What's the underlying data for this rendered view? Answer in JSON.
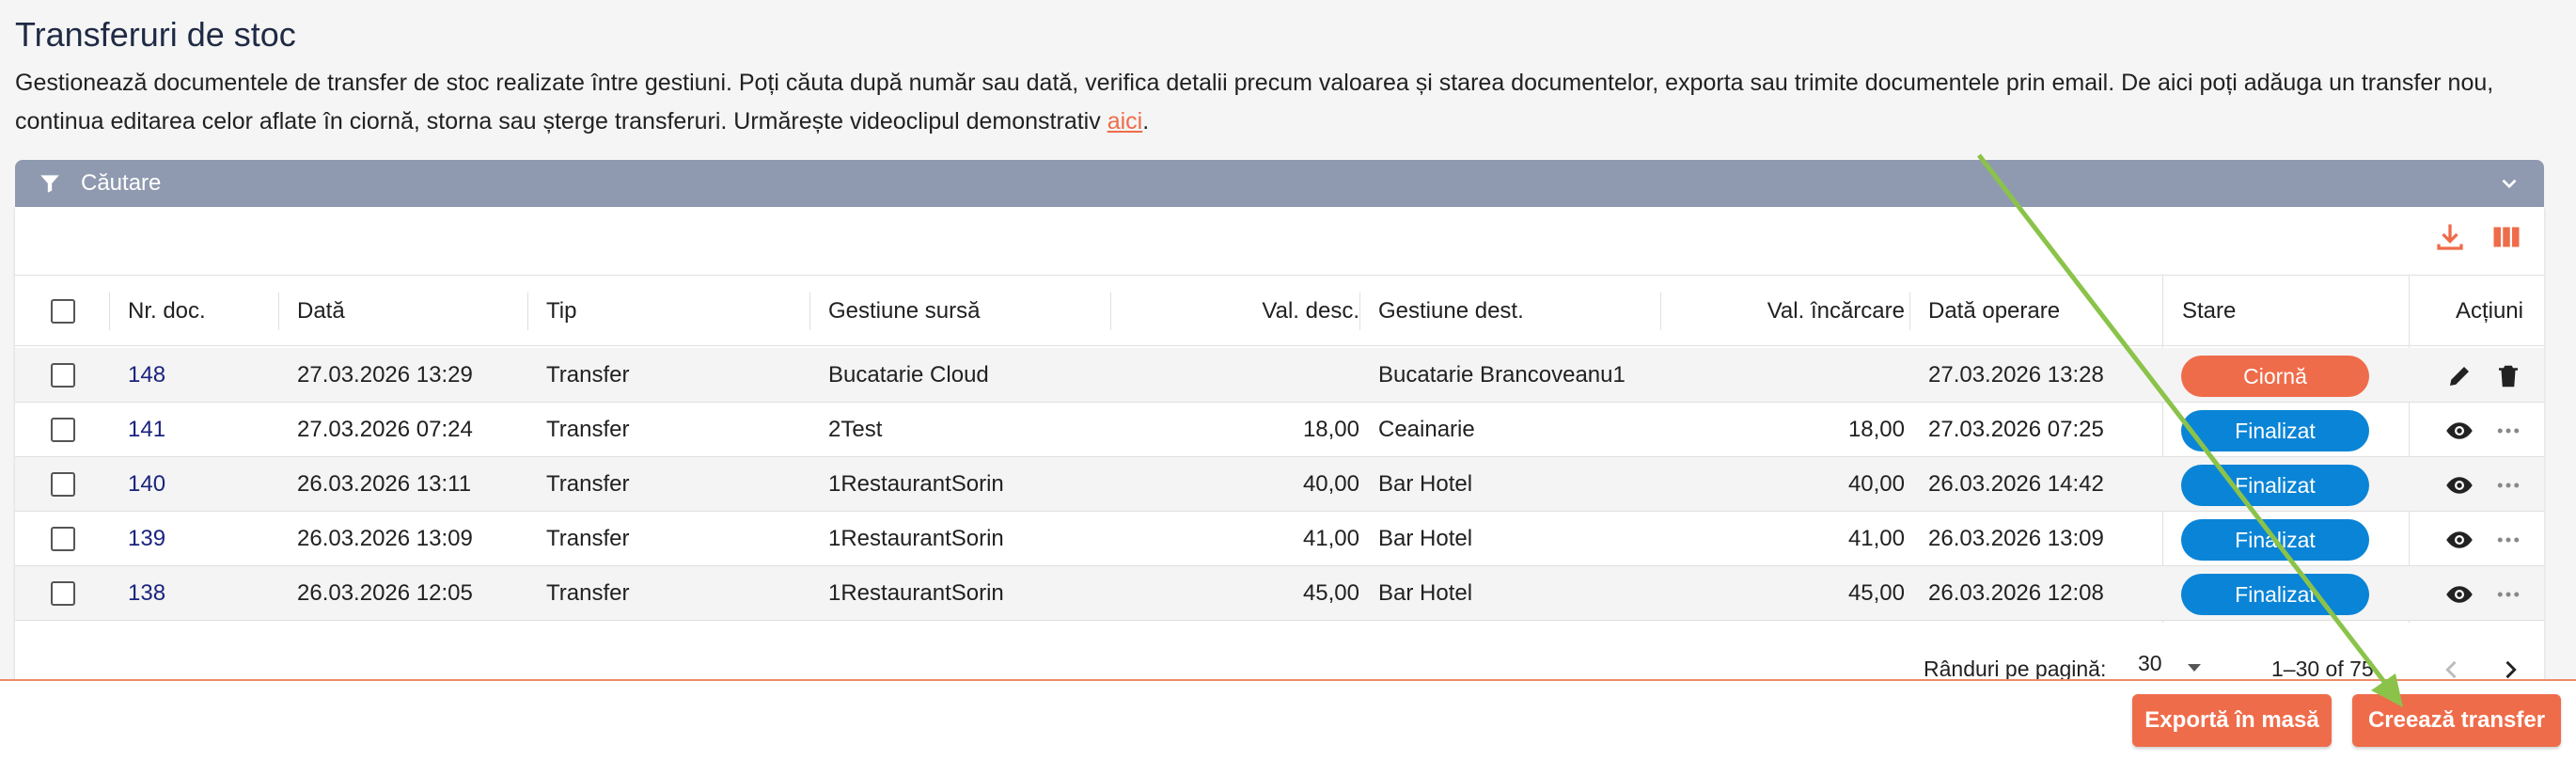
{
  "page": {
    "title": "Transferuri de stoc",
    "description": "Gestionează documentele de transfer de stoc realizate între gestiuni. Poți căuta după număr sau dată, verifica detalii precum valoarea și starea documentelor, exporta sau trimite documentele prin email. De aici poți adăuga un transfer nou, continua editarea celor aflate în ciornă, storna sau șterge transferuri. Urmărește videoclipul demonstrativ ",
    "link_text": "aici",
    "description_end": "."
  },
  "search": {
    "label": "Căutare"
  },
  "table": {
    "columns": {
      "nr_doc": "Nr. doc.",
      "data": "Dată",
      "tip": "Tip",
      "gestiune_sursa": "Gestiune sursă",
      "val_desc": "Val. desc.",
      "gestiune_dest": "Gestiune dest.",
      "val_incarcare": "Val. încărcare",
      "data_operare": "Dată operare",
      "stare": "Stare",
      "actiuni": "Acțiuni"
    },
    "rows": [
      {
        "nr": "148",
        "data": "27.03.2026 13:29",
        "tip": "Transfer",
        "sursa": "Bucatarie Cloud",
        "val_desc": "",
        "dest": "Bucatarie Brancoveanu1",
        "val_inc": "",
        "data_op": "27.03.2026 13:28",
        "stare": "Ciornă"
      },
      {
        "nr": "141",
        "data": "27.03.2026 07:24",
        "tip": "Transfer",
        "sursa": "2Test",
        "val_desc": "18,00",
        "dest": "Ceainarie",
        "val_inc": "18,00",
        "data_op": "27.03.2026 07:25",
        "stare": "Finalizat"
      },
      {
        "nr": "140",
        "data": "26.03.2026 13:11",
        "tip": "Transfer",
        "sursa": "1RestaurantSorin",
        "val_desc": "40,00",
        "dest": "Bar Hotel",
        "val_inc": "40,00",
        "data_op": "26.03.2026 14:42",
        "stare": "Finalizat"
      },
      {
        "nr": "139",
        "data": "26.03.2026 13:09",
        "tip": "Transfer",
        "sursa": "1RestaurantSorin",
        "val_desc": "41,00",
        "dest": "Bar Hotel",
        "val_inc": "41,00",
        "data_op": "26.03.2026 13:09",
        "stare": "Finalizat"
      },
      {
        "nr": "138",
        "data": "26.03.2026 12:05",
        "tip": "Transfer",
        "sursa": "1RestaurantSorin",
        "val_desc": "45,00",
        "dest": "Bar Hotel",
        "val_inc": "45,00",
        "data_op": "26.03.2026 12:08",
        "stare": "Finalizat"
      }
    ]
  },
  "pagination": {
    "label": "Rânduri pe pagină:",
    "value": "30",
    "range": "1–30 of 75"
  },
  "actions": {
    "export": "Exportă în masă",
    "create": "Creează transfer"
  },
  "colors": {
    "accent": "#ef6c4a",
    "finalizat": "#0a84d6",
    "ciorna": "#ef6c4a",
    "header_bar": "#8f9ab0",
    "annotation_arrow": "#8bc34a"
  },
  "icons": [
    "filter-icon",
    "chevron-down-icon",
    "download-icon",
    "columns-icon",
    "edit-icon",
    "delete-icon",
    "view-icon",
    "more-icon",
    "chevron-left-icon",
    "chevron-right-icon",
    "dropdown-icon"
  ]
}
